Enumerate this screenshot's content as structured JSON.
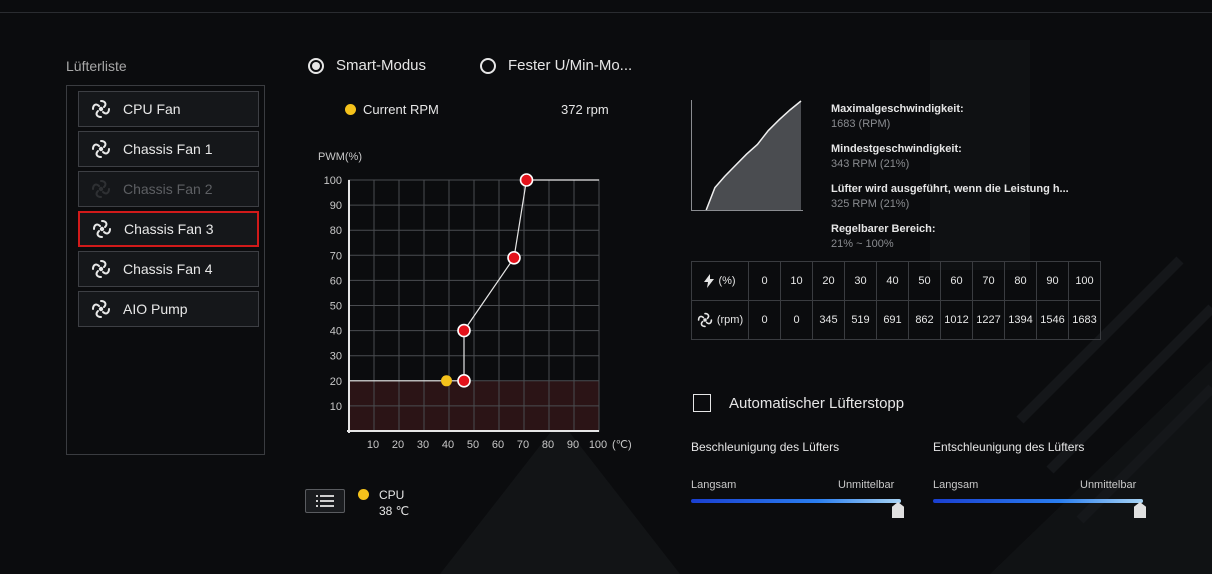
{
  "fan_list": {
    "title": "Lüfterliste",
    "items": [
      {
        "label": "CPU Fan",
        "state": "normal"
      },
      {
        "label": "Chassis Fan 1",
        "state": "normal"
      },
      {
        "label": "Chassis Fan 2",
        "state": "disabled"
      },
      {
        "label": "Chassis Fan 3",
        "state": "selected"
      },
      {
        "label": "Chassis Fan 4",
        "state": "normal"
      },
      {
        "label": "AIO Pump",
        "state": "normal"
      }
    ]
  },
  "modes": {
    "smart_label": "Smart-Modus",
    "fixed_label": "Fester U/Min-Mo...",
    "selected": "smart"
  },
  "current": {
    "label": "Current RPM",
    "value": "372 rpm"
  },
  "curve": {
    "ylabel": "PWM(%)",
    "xunit": "(℃)",
    "x_ticks": [
      10,
      20,
      30,
      40,
      50,
      60,
      70,
      80,
      90,
      100
    ],
    "y_ticks": [
      100,
      90,
      80,
      70,
      60,
      50,
      40,
      30,
      20,
      10
    ],
    "x_range": [
      0,
      100
    ],
    "y_range": [
      0,
      100
    ],
    "points": [
      {
        "t": 46,
        "pwm": 20
      },
      {
        "t": 46,
        "pwm": 40
      },
      {
        "t": 66,
        "pwm": 69
      },
      {
        "t": 71,
        "pwm": 100
      }
    ],
    "current_point": {
      "t": 39,
      "pwm": 20
    },
    "min_zone_pwm": 20,
    "colors": {
      "point": "#e3121b",
      "current": "#f5c21b",
      "line": "#e6e6e6",
      "zone": "#2b1416"
    }
  },
  "sensor": {
    "name": "CPU",
    "value": "38 ℃",
    "button_icon": "list-icon"
  },
  "info": [
    {
      "key": "Maximalgeschwindigkeit:",
      "value": "1683 (RPM)"
    },
    {
      "key": "Mindestgeschwindigkeit:",
      "value": "343 RPM (21%)"
    },
    {
      "key": "Lüfter wird ausgeführt, wenn die Leistung h...",
      "value": "325 RPM (21%)"
    },
    {
      "key": "Regelbarer Bereich:",
      "value": "21% ~ 100%"
    }
  ],
  "mini_curve": {
    "pwm": [
      21,
      30,
      40,
      50,
      60,
      70,
      80,
      90,
      100
    ],
    "rpm": [
      345,
      519,
      691,
      862,
      1012,
      1227,
      1394,
      1546,
      1683
    ],
    "max_rpm": 1683
  },
  "table": {
    "power_unit": "(%)",
    "rpm_unit": "(rpm)",
    "power_row": [
      "0",
      "10",
      "20",
      "30",
      "40",
      "50",
      "60",
      "70",
      "80",
      "90",
      "100"
    ],
    "rpm_row": [
      "0",
      "0",
      "345",
      "519",
      "691",
      "862",
      "1012",
      "1227",
      "1394",
      "1546",
      "1683"
    ]
  },
  "auto_stop": {
    "label": "Automatischer Lüfterstopp",
    "checked": false
  },
  "sliders": {
    "accel": {
      "title": "Beschleunigung des Lüfters",
      "min": "Langsam",
      "max": "Unmittelbar",
      "level": 1.0
    },
    "decel": {
      "title": "Entschleunigung des Lüfters",
      "min": "Langsam",
      "max": "Unmittelbar",
      "level": 1.0
    }
  }
}
